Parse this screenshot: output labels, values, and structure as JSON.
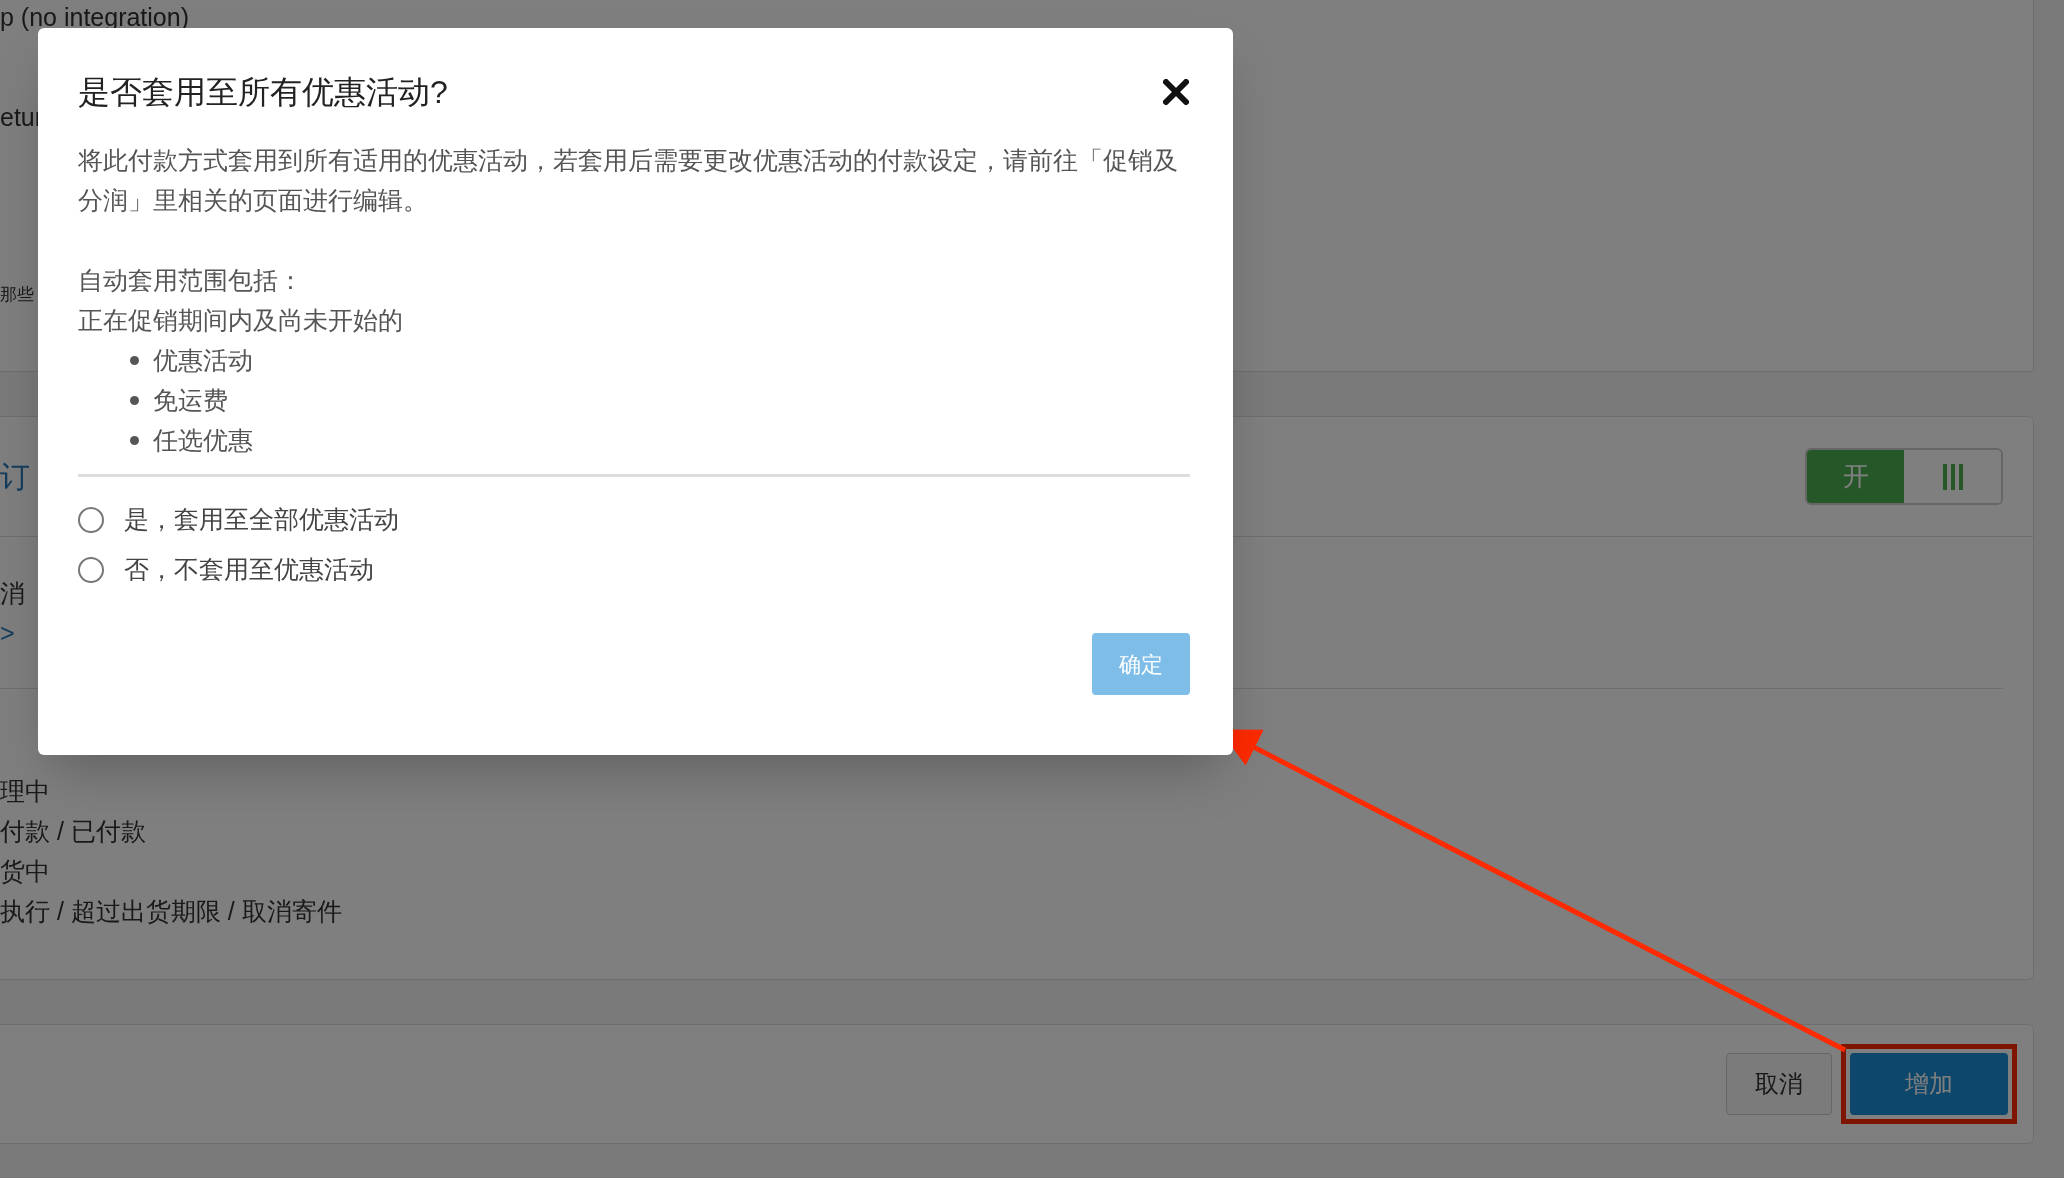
{
  "background": {
    "top_panel_lines": [
      "p (no integration)",
      "etur",
      "那些"
    ],
    "section_title": "订",
    "section_text": "消",
    "section_link": ">",
    "status_lines": [
      "理中",
      "付款 / 已付款",
      "货中",
      "执行 / 超过出货期限 / 取消寄件"
    ],
    "toggle": {
      "label": "开",
      "on": true
    }
  },
  "footer_buttons": [
    {
      "label": "取消",
      "kind": "secondary",
      "highlighted": false
    },
    {
      "label": "增加",
      "kind": "primary",
      "highlighted": true
    }
  ],
  "dialog": {
    "title": "是否套用至所有优惠活动?",
    "description": "将此付款方式套用到所有适用的优惠活动，若套用后需要更改优惠活动的付款设定，请前往「促销及分润」里相关的页面进行编辑。",
    "scope_heading": "自动套用范围包括：",
    "scope_intro": "正在促销期间内及尚未开始的",
    "scope_items": [
      "优惠活动",
      "免运费",
      "任选优惠"
    ],
    "options": [
      {
        "label": "是，套用至全部优惠活动",
        "selected": false
      },
      {
        "label": "否，不套用至优惠活动",
        "selected": false
      }
    ],
    "confirm": "确定"
  }
}
